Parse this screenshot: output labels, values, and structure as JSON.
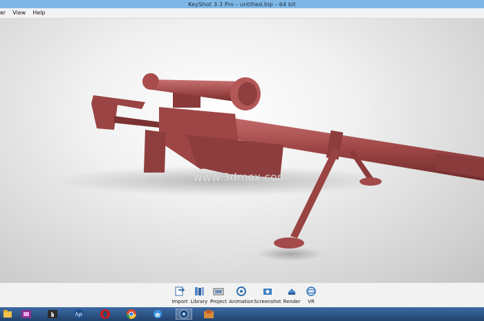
{
  "window": {
    "title": "KeyShot 3.3 Pro  - untitled.bip  - 64 bit"
  },
  "menu": {
    "items": [
      {
        "label": "er"
      },
      {
        "label": "View"
      },
      {
        "label": "Help"
      }
    ]
  },
  "viewport": {
    "model_color": "#9e4646",
    "watermark_text": "www.3dmox.com"
  },
  "toolbar": {
    "buttons": [
      {
        "label": "Import",
        "icon": "import-icon"
      },
      {
        "label": "Library",
        "icon": "library-icon"
      },
      {
        "label": "Project",
        "icon": "project-icon"
      },
      {
        "label": "Animation",
        "icon": "animation-icon"
      },
      {
        "label": "Screenshot",
        "icon": "screenshot-icon"
      },
      {
        "label": "Render",
        "icon": "render-icon"
      },
      {
        "label": "VR",
        "icon": "vr-icon"
      }
    ]
  },
  "taskbar": {
    "apps": [
      {
        "icon": "file-explorer-icon"
      },
      {
        "icon": "media-app-icon"
      },
      {
        "icon": "touch-app-icon"
      },
      {
        "icon": "hp-icon"
      },
      {
        "icon": "opera-icon"
      },
      {
        "icon": "chrome-icon"
      },
      {
        "icon": "internet-explorer-icon"
      },
      {
        "icon": "keyshot-icon"
      },
      {
        "icon": "folder-app-icon"
      }
    ]
  }
}
